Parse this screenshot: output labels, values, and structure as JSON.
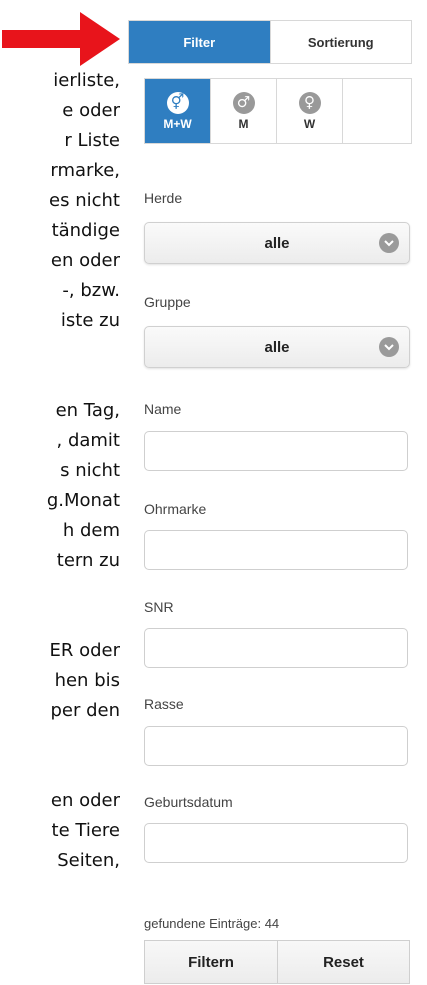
{
  "background_text_lines": [
    "ierliste,",
    "e oder",
    "r Liste",
    "rmarke,",
    "es nicht",
    "tändige",
    "en oder",
    "-, bzw.",
    "iste zu",
    "",
    "",
    "en Tag,",
    ", damit",
    "s nicht",
    "g.Monat",
    "h dem",
    "tern zu",
    "",
    "",
    "ER oder",
    "hen bis",
    "per den",
    "",
    "",
    "en oder",
    "te Tiere",
    " Seiten,"
  ],
  "tabs": {
    "filter": "Filter",
    "sort": "Sortierung"
  },
  "gender": {
    "all": "M+W",
    "male": "M",
    "female": "W"
  },
  "fields": {
    "herde": {
      "label": "Herde",
      "value": "alle"
    },
    "gruppe": {
      "label": "Gruppe",
      "value": "alle"
    },
    "name": {
      "label": "Name",
      "value": ""
    },
    "ohrmarke": {
      "label": "Ohrmarke",
      "value": ""
    },
    "snr": {
      "label": "SNR",
      "value": ""
    },
    "rasse": {
      "label": "Rasse",
      "value": ""
    },
    "geburtsdatum": {
      "label": "Geburtsdatum",
      "value": ""
    }
  },
  "result_count": "gefundene Einträge: 44",
  "buttons": {
    "filter": "Filtern",
    "reset": "Reset"
  },
  "colors": {
    "accent": "#2f7ec1",
    "arrow": "#e8141b"
  }
}
